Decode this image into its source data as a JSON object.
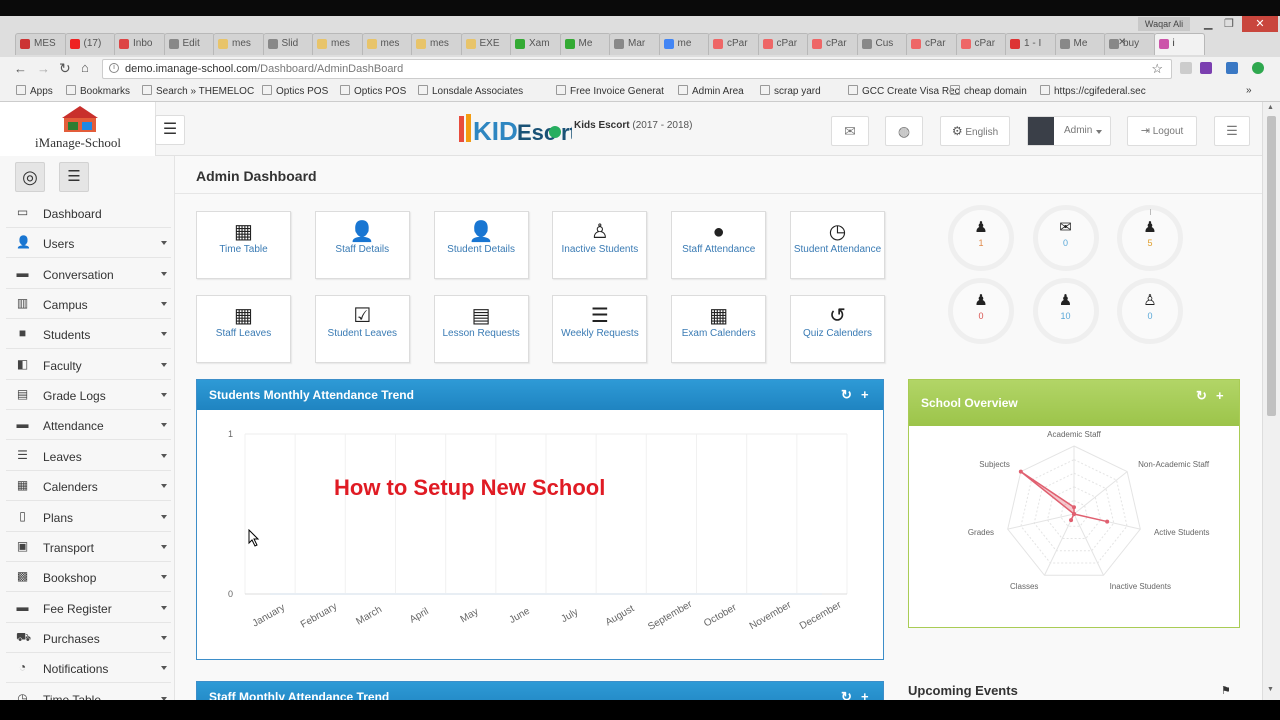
{
  "browser": {
    "tabs": [
      {
        "label": "MES",
        "color": "#c33"
      },
      {
        "label": "(17)",
        "color": "#e22"
      },
      {
        "label": "Inbo",
        "color": "#d44"
      },
      {
        "label": "Edit",
        "color": "#888"
      },
      {
        "label": "mes",
        "color": "#e8c46a"
      },
      {
        "label": "Slid",
        "color": "#888"
      },
      {
        "label": "mes",
        "color": "#e8c46a"
      },
      {
        "label": "mes",
        "color": "#e8c46a"
      },
      {
        "label": "mes",
        "color": "#e8c46a"
      },
      {
        "label": "EXE",
        "color": "#e8c46a"
      },
      {
        "label": "Xam",
        "color": "#3a3"
      },
      {
        "label": "Me",
        "color": "#3a3"
      },
      {
        "label": "Mar",
        "color": "#888"
      },
      {
        "label": "me",
        "color": "#4285f4"
      },
      {
        "label": "cPar",
        "color": "#e66"
      },
      {
        "label": "cPar",
        "color": "#e66"
      },
      {
        "label": "cPar",
        "color": "#e66"
      },
      {
        "label": "Cus",
        "color": "#888"
      },
      {
        "label": "cPar",
        "color": "#e66"
      },
      {
        "label": "cPar",
        "color": "#e66"
      },
      {
        "label": "1 - I",
        "color": "#d33"
      },
      {
        "label": "Me",
        "color": "#888"
      },
      {
        "label": "buy",
        "color": "#888"
      },
      {
        "label": "i",
        "color": "#c5a"
      }
    ],
    "user_name": "Waqar Ali",
    "url_host": "demo.imanage-school.com",
    "url_path": "/Dashboard/AdminDashBoard",
    "bookmarks": [
      "Apps",
      "Bookmarks",
      "Search » THEMELOC",
      "Optics POS",
      "Optics POS",
      "Lonsdale Associates",
      "Free Invoice Generat",
      "Admin Area",
      "scrap yard",
      "GCC Create Visa Rec",
      "cheap domain",
      "https://cgifederal.sec"
    ]
  },
  "header": {
    "logo_text": "iManage-School",
    "brand_title": "Kids Escort",
    "brand_years": "(2017 - 2018)",
    "language": "English",
    "user_role": "Admin",
    "logout_label": "Logout"
  },
  "sidebar": {
    "items": [
      {
        "label": "Dashboard",
        "icon": "monitor-icon",
        "glyph": "▭",
        "caret": false
      },
      {
        "label": "Users",
        "icon": "user-icon",
        "glyph": "👤",
        "caret": true
      },
      {
        "label": "Conversation",
        "icon": "chat-icon",
        "glyph": "▬",
        "caret": true
      },
      {
        "label": "Campus",
        "icon": "building-icon",
        "glyph": "▥",
        "caret": true
      },
      {
        "label": "Students",
        "icon": "student-icon",
        "glyph": "■",
        "caret": true
      },
      {
        "label": "Faculty",
        "icon": "faculty-icon",
        "glyph": "◧",
        "caret": true
      },
      {
        "label": "Grade Logs",
        "icon": "grade-icon",
        "glyph": "▤",
        "caret": true
      },
      {
        "label": "Attendance",
        "icon": "attendance-icon",
        "glyph": "▬",
        "caret": true
      },
      {
        "label": "Leaves",
        "icon": "leaves-icon",
        "glyph": "☰",
        "caret": true
      },
      {
        "label": "Calenders",
        "icon": "calendar-icon",
        "glyph": "▦",
        "caret": true
      },
      {
        "label": "Plans",
        "icon": "plans-icon",
        "glyph": "▯",
        "caret": true
      },
      {
        "label": "Transport",
        "icon": "bus-icon",
        "glyph": "▣",
        "caret": true
      },
      {
        "label": "Bookshop",
        "icon": "book-icon",
        "glyph": "▩",
        "caret": true
      },
      {
        "label": "Fee Register",
        "icon": "fee-icon",
        "glyph": "▬",
        "caret": true
      },
      {
        "label": "Purchases",
        "icon": "cart-icon",
        "glyph": "⛟",
        "caret": true
      },
      {
        "label": "Notifications",
        "icon": "bell-icon",
        "glyph": "◔",
        "caret": true
      },
      {
        "label": "Time Table",
        "icon": "clock-icon",
        "glyph": "◷",
        "caret": true
      }
    ]
  },
  "dashboard": {
    "title": "Admin Dashboard",
    "tiles": [
      {
        "label": "Time Table",
        "icon": "calendar-icon",
        "glyph": "▦"
      },
      {
        "label": "Staff Details",
        "icon": "staff-icon",
        "glyph": "👤"
      },
      {
        "label": "Student Details",
        "icon": "student-details-icon",
        "glyph": "👤"
      },
      {
        "label": "Inactive Students",
        "icon": "inactive-students-icon",
        "glyph": "♙"
      },
      {
        "label": "Staff Attendance",
        "icon": "clock-icon",
        "glyph": "●"
      },
      {
        "label": "Student Attendance",
        "icon": "clock-outline-icon",
        "glyph": "◷"
      },
      {
        "label": "Staff Leaves",
        "icon": "calendar-icon",
        "glyph": "▦"
      },
      {
        "label": "Student Leaves",
        "icon": "check-clipboard-icon",
        "glyph": "☑"
      },
      {
        "label": "Lesson Requests",
        "icon": "clipboard-icon",
        "glyph": "▤"
      },
      {
        "label": "Weekly Requests",
        "icon": "list-icon",
        "glyph": "☰"
      },
      {
        "label": "Exam Calenders",
        "icon": "calendar-icon",
        "glyph": "▦"
      },
      {
        "label": "Quiz Calenders",
        "icon": "history-icon",
        "glyph": "↺"
      }
    ],
    "stats": [
      {
        "value": "1",
        "icon": "group-icon",
        "glyph": "♟",
        "color": "#e08a4a"
      },
      {
        "value": "0",
        "icon": "envelope-icon",
        "glyph": "✉",
        "color": "#5aa8d8"
      },
      {
        "value": "5",
        "icon": "staff-icon",
        "glyph": "♟",
        "color": "#e0a030"
      },
      {
        "value": "0",
        "icon": "user-icon",
        "glyph": "♟",
        "color": "#d9534f"
      },
      {
        "value": "10",
        "icon": "student-icon",
        "glyph": "♟",
        "color": "#5aa8d8"
      },
      {
        "value": "0",
        "icon": "inactive-icon",
        "glyph": "♙",
        "color": "#5aa8d8"
      }
    ]
  },
  "attendance_panel": {
    "title": "Students Monthly Attendance Trend",
    "overlay": "How to Setup New School"
  },
  "overview_panel": {
    "title": "School Overview"
  },
  "staff_panel": {
    "title": "Staff Monthly Attendance Trend"
  },
  "upcoming_events": {
    "title": "Upcoming Events"
  },
  "chart_data": [
    {
      "type": "line",
      "title": "Students Monthly Attendance Trend",
      "categories": [
        "January",
        "February",
        "March",
        "April",
        "May",
        "June",
        "July",
        "August",
        "September",
        "October",
        "November",
        "December"
      ],
      "series": [
        {
          "values": [
            0,
            0,
            0,
            0,
            0,
            0,
            0,
            0,
            0,
            0,
            0,
            0
          ]
        }
      ],
      "ylim": [
        0,
        1
      ],
      "yticks": [
        "1",
        "0"
      ],
      "grid": true
    },
    {
      "type": "radar",
      "title": "School Overview",
      "categories": [
        "Academic Staff",
        "Non-Academic Staff",
        "Active Students",
        "Inactive Students",
        "Classes",
        "Grades",
        "Subjects"
      ],
      "series": [
        {
          "values": [
            1,
            0,
            5,
            0,
            1,
            0,
            10
          ]
        }
      ],
      "color": "#e06070"
    }
  ]
}
